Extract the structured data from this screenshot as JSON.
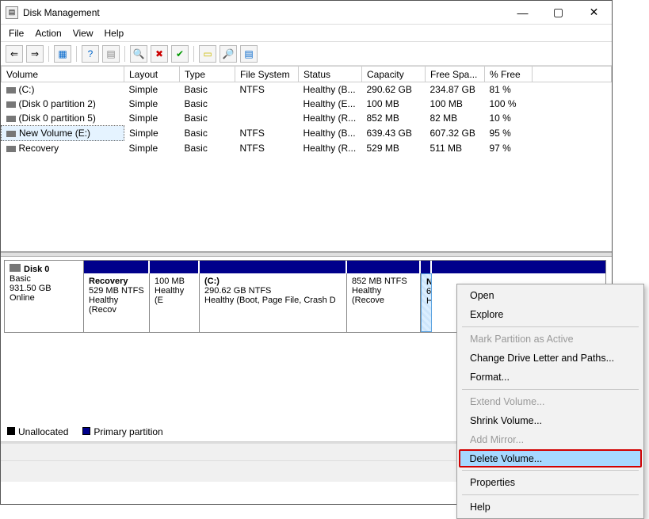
{
  "titlebar": {
    "title": "Disk Management"
  },
  "menubar": {
    "file": "File",
    "action": "Action",
    "view": "View",
    "help": "Help"
  },
  "columns": {
    "volume": "Volume",
    "layout": "Layout",
    "type": "Type",
    "fs": "File System",
    "status": "Status",
    "capacity": "Capacity",
    "free": "Free Spa...",
    "pct": "% Free"
  },
  "volumes": [
    {
      "name": "(C:)",
      "layout": "Simple",
      "type": "Basic",
      "fs": "NTFS",
      "status": "Healthy (B...",
      "cap": "290.62 GB",
      "free": "234.87 GB",
      "pct": "81 %",
      "selected": false
    },
    {
      "name": "(Disk 0 partition 2)",
      "layout": "Simple",
      "type": "Basic",
      "fs": "",
      "status": "Healthy (E...",
      "cap": "100 MB",
      "free": "100 MB",
      "pct": "100 %",
      "selected": false
    },
    {
      "name": "(Disk 0 partition 5)",
      "layout": "Simple",
      "type": "Basic",
      "fs": "",
      "status": "Healthy (R...",
      "cap": "852 MB",
      "free": "82 MB",
      "pct": "10 %",
      "selected": false
    },
    {
      "name": "New Volume (E:)",
      "layout": "Simple",
      "type": "Basic",
      "fs": "NTFS",
      "status": "Healthy (B...",
      "cap": "639.43 GB",
      "free": "607.32 GB",
      "pct": "95 %",
      "selected": true
    },
    {
      "name": "Recovery",
      "layout": "Simple",
      "type": "Basic",
      "fs": "NTFS",
      "status": "Healthy (R...",
      "cap": "529 MB",
      "free": "511 MB",
      "pct": "97 %",
      "selected": false
    }
  ],
  "disk": {
    "name": "Disk 0",
    "type": "Basic",
    "size": "931.50 GB",
    "status": "Online",
    "partitions": [
      {
        "title": "Recovery",
        "sub": "529 MB NTFS",
        "sub2": "Healthy (Recov",
        "w": 83
      },
      {
        "title": "",
        "sub": "100 MB",
        "sub2": "Healthy (E",
        "w": 63
      },
      {
        "title": "(C:)",
        "sub": "290.62 GB NTFS",
        "sub2": "Healthy (Boot, Page File, Crash D",
        "w": 186
      },
      {
        "title": "",
        "sub": "852 MB NTFS",
        "sub2": "Healthy (Recove",
        "w": 93
      },
      {
        "title": "N",
        "sub": "6",
        "sub2": "H",
        "w": 14,
        "selected": true
      }
    ]
  },
  "legend": {
    "unalloc": "Unallocated",
    "primary": "Primary partition"
  },
  "context": {
    "open": "Open",
    "explore": "Explore",
    "mark": "Mark Partition as Active",
    "change": "Change Drive Letter and Paths...",
    "format": "Format...",
    "extend": "Extend Volume...",
    "shrink": "Shrink Volume...",
    "mirror": "Add Mirror...",
    "delete": "Delete Volume...",
    "props": "Properties",
    "help": "Help"
  }
}
